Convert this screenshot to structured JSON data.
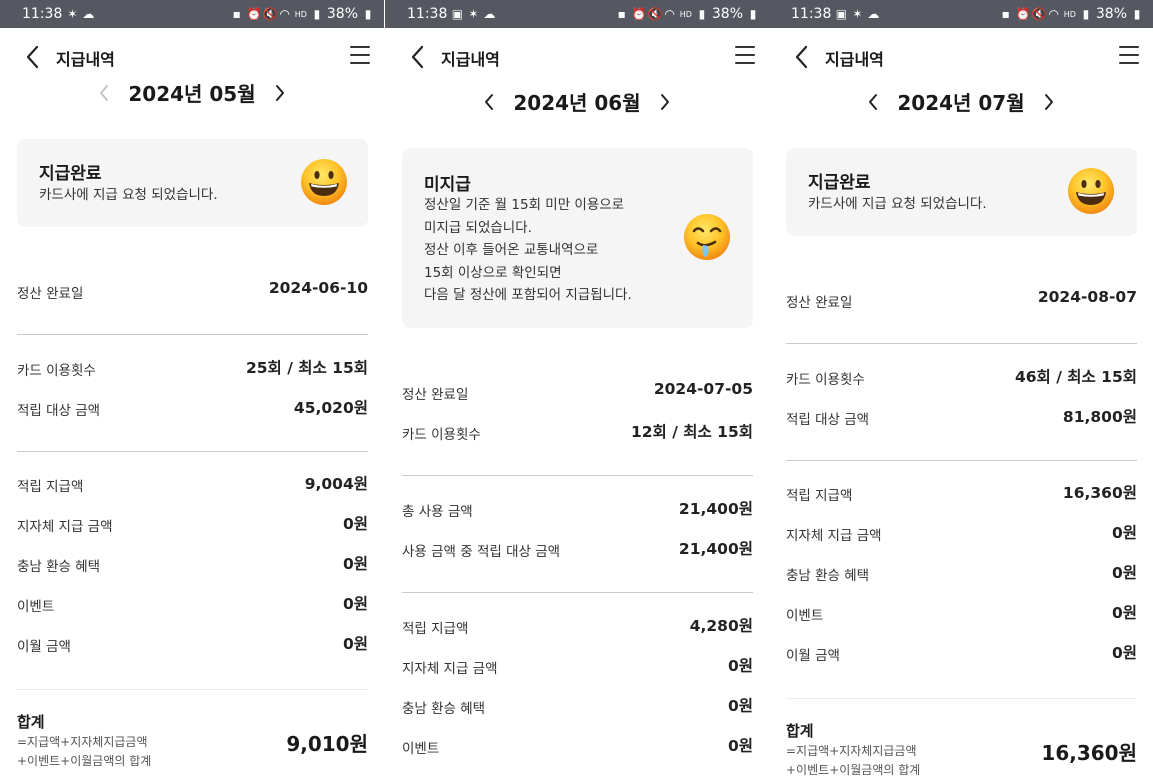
{
  "status_bar": {
    "time": "11:38",
    "battery": "38%",
    "network": "HD"
  },
  "header": {
    "title": "지급내역"
  },
  "panels": [
    {
      "month": "2024년 05월",
      "card": {
        "title": "지급완료",
        "lines": [
          "카드사에 지급 요청 되었습니다."
        ],
        "emoji": "grinning-face-icon"
      },
      "settle": {
        "label": "정산 완료일",
        "value": "2024-06-10"
      },
      "usage": [
        {
          "label": "카드 이용횟수",
          "value": "25회 / 최소 15회"
        },
        {
          "label": "적립 대상 금액",
          "value": "45,020원"
        }
      ],
      "payout": [
        {
          "label": "적립 지급액",
          "value": "9,004원"
        },
        {
          "label": "지자체 지급 금액",
          "value": "0원"
        },
        {
          "label": "충남 환승 혜택",
          "value": "0원"
        },
        {
          "label": "이벤트",
          "value": "0원"
        },
        {
          "label": "이월 금액",
          "value": "0원"
        }
      ],
      "total": {
        "title": "합계",
        "note1": "=지급액+지자체지급금액",
        "note2": "+이벤트+이월금액의 합계",
        "value": "9,010원"
      }
    },
    {
      "month": "2024년 06월",
      "card": {
        "title": "미지급",
        "lines": [
          "정산일 기준 월 15회 미만 이용으로",
          "미지급 되었습니다.",
          "정산 이후 들어온 교통내역으로",
          "15회 이상으로 확인되면",
          "다음 달 정산에 포함되어 지급됩니다."
        ],
        "emoji": "drooling-face-icon"
      },
      "settle": {
        "label": "정산 완료일",
        "value": "2024-07-05"
      },
      "usage": [
        {
          "label": "카드 이용횟수",
          "value": "12회 / 최소 15회"
        }
      ],
      "amounts": [
        {
          "label": "총 사용 금액",
          "value": "21,400원"
        },
        {
          "label": "사용 금액 중 적립 대상 금액",
          "value": "21,400원"
        }
      ],
      "payout": [
        {
          "label": "적립 지급액",
          "value": "4,280원"
        },
        {
          "label": "지자체 지급 금액",
          "value": "0원"
        },
        {
          "label": "충남 환승 혜택",
          "value": "0원"
        },
        {
          "label": "이벤트",
          "value": "0원"
        }
      ]
    },
    {
      "month": "2024년 07월",
      "card": {
        "title": "지급완료",
        "lines": [
          "카드사에 지급 요청 되었습니다."
        ],
        "emoji": "grinning-face-icon"
      },
      "settle": {
        "label": "정산 완료일",
        "value": "2024-08-07"
      },
      "usage": [
        {
          "label": "카드 이용횟수",
          "value": "46회 / 최소 15회"
        },
        {
          "label": "적립 대상 금액",
          "value": "81,800원"
        }
      ],
      "payout": [
        {
          "label": "적립 지급액",
          "value": "16,360원"
        },
        {
          "label": "지자체 지급 금액",
          "value": "0원"
        },
        {
          "label": "충남 환승 혜택",
          "value": "0원"
        },
        {
          "label": "이벤트",
          "value": "0원"
        },
        {
          "label": "이월 금액",
          "value": "0원"
        }
      ],
      "total": {
        "title": "합계",
        "note1": "=지급액+지자체지급금액",
        "note2": "+이벤트+이월금액의 합계",
        "value": "16,360원"
      }
    }
  ]
}
